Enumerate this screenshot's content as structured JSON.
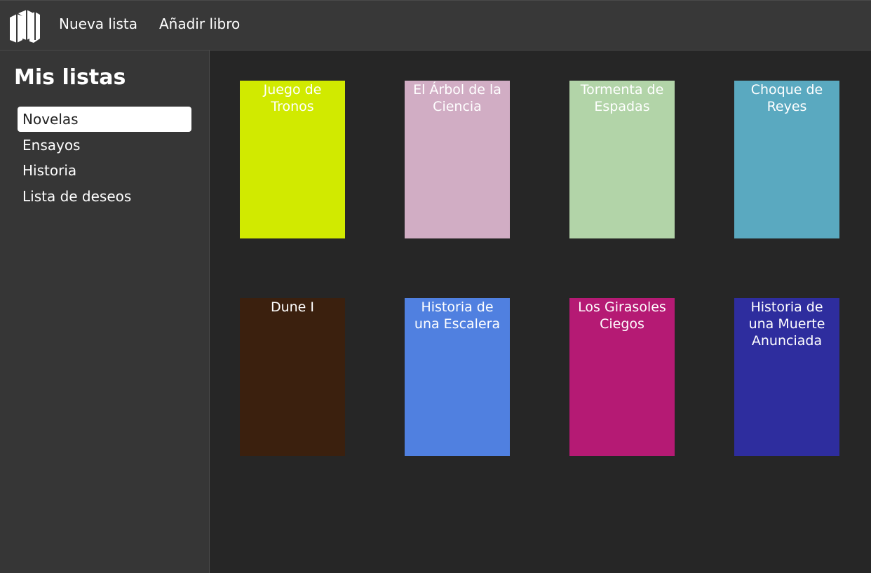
{
  "topbar": {
    "logo_icon": "books-icon",
    "new_list_label": "Nueva lista",
    "add_book_label": "Añadir libro"
  },
  "sidebar": {
    "title": "Mis listas",
    "items": [
      {
        "label": "Novelas",
        "selected": true
      },
      {
        "label": "Ensayos",
        "selected": false
      },
      {
        "label": "Historia",
        "selected": false
      },
      {
        "label": "Lista de deseos",
        "selected": false
      }
    ]
  },
  "books": [
    {
      "title": "Juego de Tronos",
      "color": "#d1ea00"
    },
    {
      "title": "El Árbol de la Ciencia",
      "color": "#d1adc4"
    },
    {
      "title": "Tormenta de Espadas",
      "color": "#b2d4a8"
    },
    {
      "title": "Choque de Reyes",
      "color": "#5aa9c0"
    },
    {
      "title": "Dune I",
      "color": "#3b200e"
    },
    {
      "title": "Historia de una Escalera",
      "color": "#5080e0"
    },
    {
      "title": "Los Girasoles Ciegos",
      "color": "#b51a74"
    },
    {
      "title": "Historia de una Muerte Anunciada",
      "color": "#2e2d9e"
    }
  ]
}
